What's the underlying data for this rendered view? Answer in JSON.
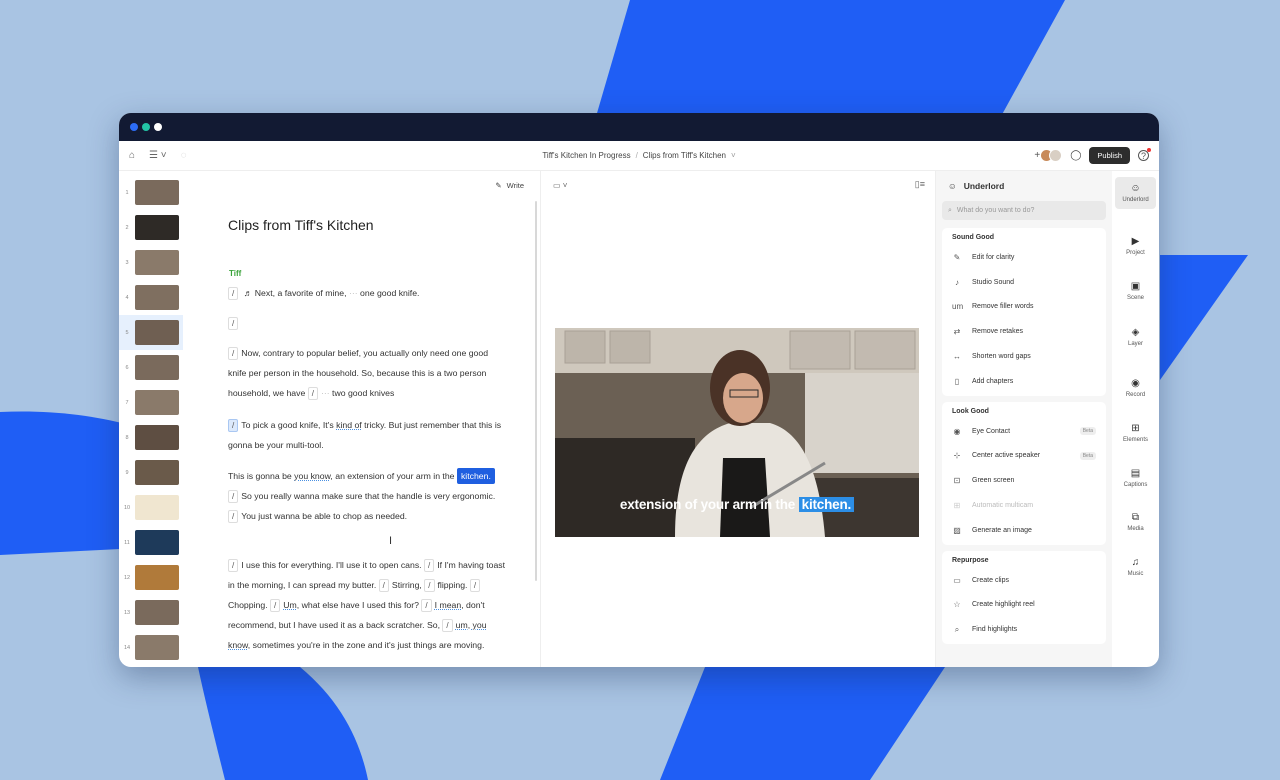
{
  "colors": {
    "accent": "#1f5fe0",
    "speaker": "#3aa33a",
    "caption_highlight": "#2c8ee6"
  },
  "breadcrumb": {
    "project": "Tiff's Kitchen In Progress",
    "separator": "/",
    "current": "Clips from Tiff's Kitchen"
  },
  "toolbar": {
    "publish": "Publish",
    "add": "+"
  },
  "thumbs": [
    "1",
    "2",
    "3",
    "4",
    "5",
    "6",
    "7",
    "8",
    "9",
    "10",
    "11",
    "12",
    "13",
    "14"
  ],
  "script": {
    "write": "Write",
    "title": "Clips from Tiff's Kitchen",
    "speaker": "Tiff",
    "p1": {
      "a": "Next, a favorite of mine,",
      "b": "one good knife."
    },
    "p3": {
      "a": "Now, contrary to popular belief, you actually only need one good knife per person in the household. So, because this is a two person household, we have",
      "b": "two good knives"
    },
    "p4": {
      "a": "To pick a good knife, It's",
      "b": "kind of",
      "c": "tricky. But just remember that this is gonna be your multi-tool."
    },
    "p5": {
      "a": "This is gonna be",
      "b": "you know,",
      "c": "an extension of your arm in the",
      "hl": "kitchen.",
      "d": "So you really wanna make sure that the handle is very ergonomic.",
      "e": "You just wanna be able to chop as needed."
    },
    "p6": {
      "a": "I use this for everything.",
      "b": "I'll use it to open cans.",
      "c": "If I'm having toast in the morning, I can spread my butter.",
      "d": "Stirring,",
      "e": "flipping.",
      "f": "Chopping.",
      "g": "Um,",
      "h": "what else have I used this for?",
      "i": "I mean,",
      "j": "don't recommend, but I have used it as a back scratcher. So,",
      "k": "um, you know,",
      "l": "sometimes you're in the zone and it's just things are moving."
    }
  },
  "video": {
    "caption_a": "extension of your arm in the",
    "caption_hl": "kitchen."
  },
  "underlord": {
    "title": "Underlord",
    "search_placeholder": "What do you want to do?",
    "sections": [
      {
        "title": "Sound Good",
        "items": [
          {
            "label": "Edit for clarity",
            "icon": "✎"
          },
          {
            "label": "Studio Sound",
            "icon": "♪"
          },
          {
            "label": "Remove filler words",
            "icon": "um"
          },
          {
            "label": "Remove retakes",
            "icon": "⇄"
          },
          {
            "label": "Shorten word gaps",
            "icon": "↔"
          },
          {
            "label": "Add chapters",
            "icon": "▯"
          }
        ]
      },
      {
        "title": "Look Good",
        "items": [
          {
            "label": "Eye Contact",
            "icon": "◉",
            "badge": "Beta"
          },
          {
            "label": "Center active speaker",
            "icon": "⊹",
            "badge": "Beta"
          },
          {
            "label": "Green screen",
            "icon": "⊡"
          },
          {
            "label": "Automatic multicam",
            "icon": "⊞",
            "disabled": true
          },
          {
            "label": "Generate an image",
            "icon": "▨"
          }
        ]
      },
      {
        "title": "Repurpose",
        "items": [
          {
            "label": "Create clips",
            "icon": "▭"
          },
          {
            "label": "Create highlight reel",
            "icon": "☆"
          },
          {
            "label": "Find highlights",
            "icon": "⌕"
          }
        ]
      }
    ]
  },
  "rail": [
    {
      "label": "Underlord",
      "icon": "☺"
    },
    {
      "label": "Project",
      "icon": "▶"
    },
    {
      "label": "Scene",
      "icon": "▣"
    },
    {
      "label": "Layer",
      "icon": "◈"
    },
    {
      "label": "Record",
      "icon": "◉"
    },
    {
      "label": "Elements",
      "icon": "⊞"
    },
    {
      "label": "Captions",
      "icon": "▤"
    },
    {
      "label": "Media",
      "icon": "⧉"
    },
    {
      "label": "Music",
      "icon": "♫"
    }
  ]
}
